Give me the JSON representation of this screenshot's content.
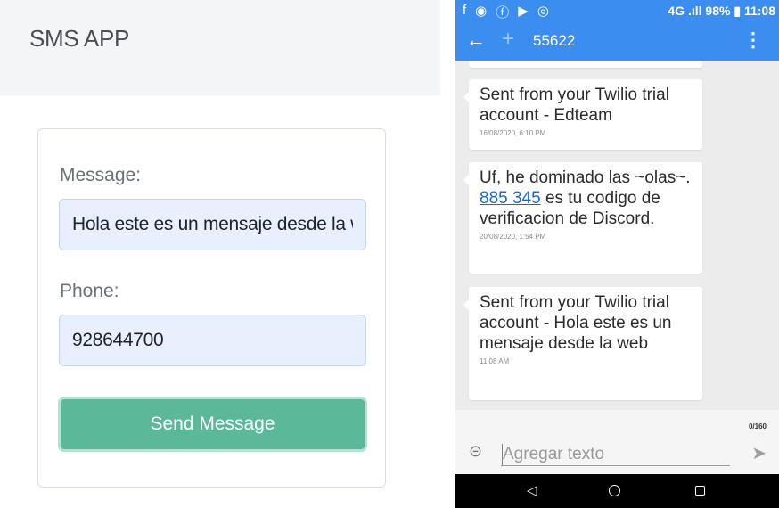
{
  "web": {
    "brand": "SMS APP",
    "form": {
      "message_label": "Message:",
      "message_value": "Hola este es un mensaje desde la web",
      "phone_label": "Phone:",
      "phone_value": "928644700",
      "send_label": "Send Message"
    },
    "colors": {
      "header_bg": "#f4f5f7",
      "input_bg": "#e8f0fe",
      "button": "#5bb898"
    }
  },
  "phone": {
    "status_bar": {
      "left_icons": [
        "facebook-icon",
        "messenger-icon",
        "facebook-icon",
        "youtube-icon",
        "hotspot-icon"
      ],
      "left_glyphs": [
        "f",
        "◉",
        "ⓕ",
        "▶",
        "◎"
      ],
      "network": "4G",
      "battery": "98%",
      "time": "11:08"
    },
    "app_bar": {
      "title": "55622",
      "color": "#3b8ef0"
    },
    "messages": [
      {
        "text": "Sent from your Twilio trial account - Edteam",
        "time": "16/08/2020, 6:10 PM"
      },
      {
        "text_before": "Uf, he dominado las ~olas~. ",
        "code": "885 345",
        "text_after": " es tu codigo de verificacion de Discord.",
        "time": "20/08/2020, 1:54 PM"
      },
      {
        "text": "Sent from your Twilio trial account - Hola este es un mensaje desde la web",
        "time": "11:08 AM"
      }
    ],
    "composer": {
      "counter": "0/160",
      "placeholder": "Agregar texto"
    },
    "nav_bar": {
      "icons": [
        "back-triangle-icon",
        "home-circle-icon",
        "recents-square-icon"
      ]
    }
  }
}
